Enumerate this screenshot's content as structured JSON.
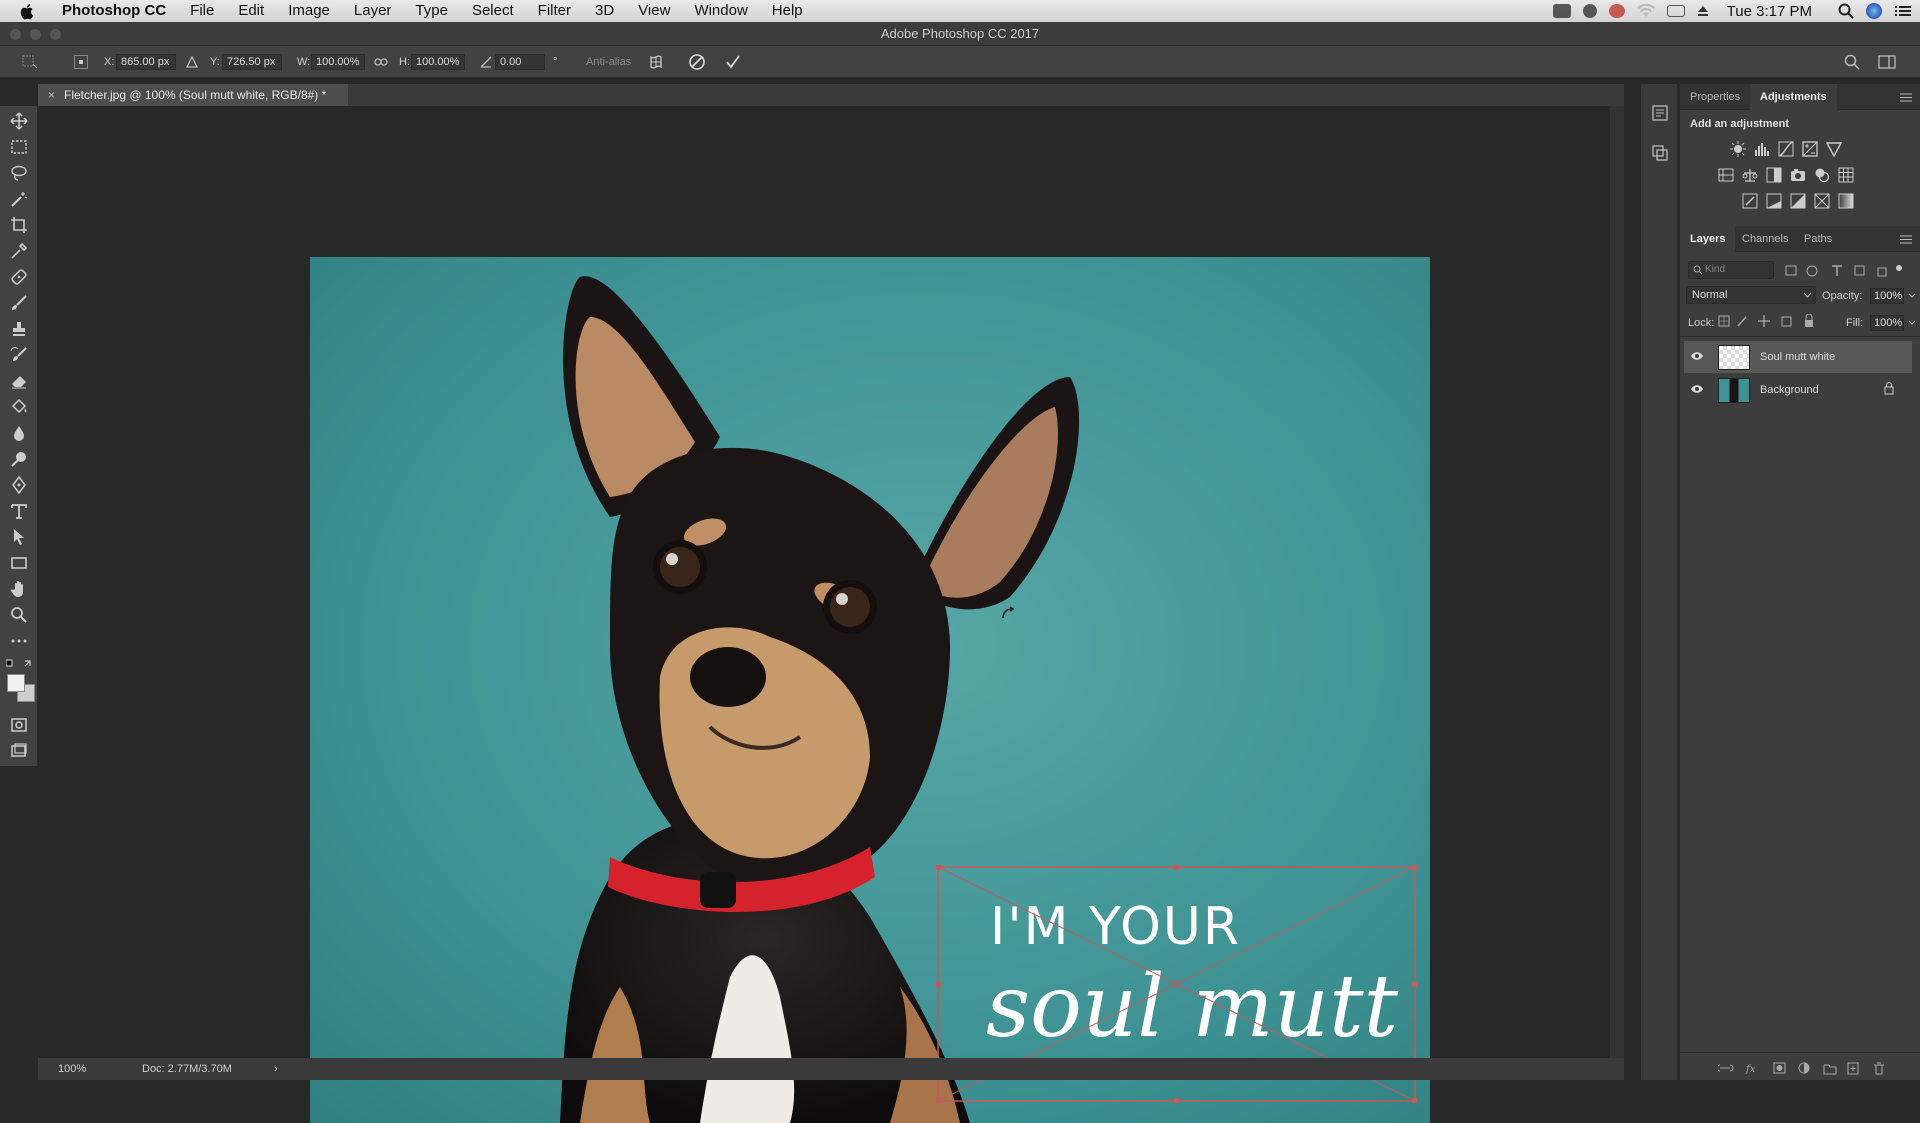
{
  "menubar": {
    "app_name": "Photoshop CC",
    "items": [
      "File",
      "Edit",
      "Image",
      "Layer",
      "Type",
      "Select",
      "Filter",
      "3D",
      "View",
      "Window",
      "Help"
    ],
    "clock": "Tue 3:17 PM"
  },
  "window_title": "Adobe Photoshop CC 2017",
  "options_bar": {
    "x_label": "X:",
    "x_value": "865.00 px",
    "y_label": "Y:",
    "y_value": "726.50 px",
    "w_label": "W:",
    "w_value": "100.00%",
    "h_label": "H:",
    "h_value": "100.00%",
    "angle_value": "0.00",
    "angle_unit": "°",
    "antialias_label": "Anti-alias"
  },
  "document_tab": {
    "title": "Fletcher.jpg @ 100% (Soul mutt white, RGB/8#) *",
    "close": "×"
  },
  "canvas_text": {
    "line1": "I'M YOUR",
    "line2": "soul mutt"
  },
  "statusbar": {
    "zoom": "100%",
    "doc_size": "Doc: 2.77M/3.70M",
    "arrow": "›"
  },
  "properties_panel": {
    "tabs": [
      "Properties",
      "Adjustments"
    ],
    "active_tab": "Adjustments",
    "add_label": "Add an adjustment"
  },
  "layers_panel": {
    "tabs": [
      "Layers",
      "Channels",
      "Paths"
    ],
    "active_tab": "Layers",
    "kind_placeholder": "Kind",
    "blend_mode": "Normal",
    "opacity_label": "Opacity:",
    "opacity_value": "100%",
    "lock_label": "Lock:",
    "fill_label": "Fill:",
    "fill_value": "100%",
    "layers": [
      {
        "name": "Soul mutt white",
        "selected": true,
        "locked": false
      },
      {
        "name": "Background",
        "selected": false,
        "locked": true
      }
    ]
  },
  "colors": {
    "accent_teal": "#3f9394",
    "transform_box": "#c45a5a"
  }
}
